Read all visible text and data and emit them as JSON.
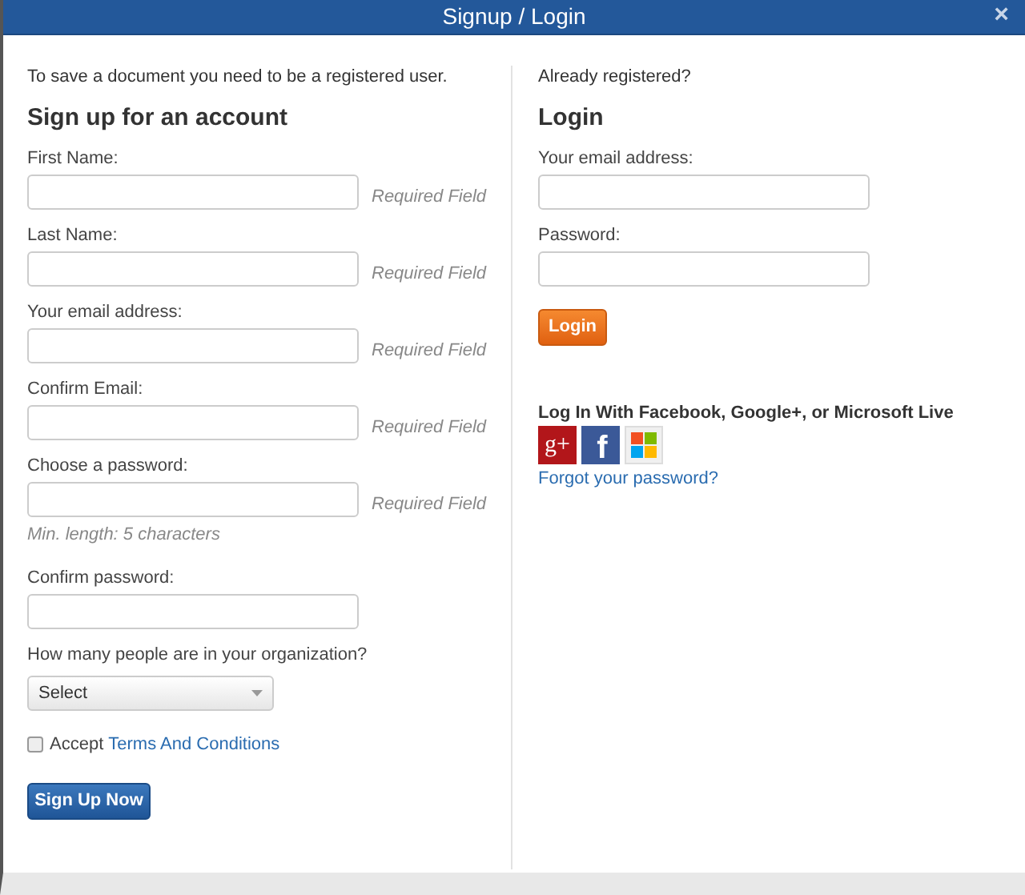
{
  "window": {
    "title": "Signup / Login",
    "close": "×"
  },
  "signup": {
    "intro": "To save a document you need to be a registered user.",
    "heading": "Sign up for an account",
    "fields": [
      {
        "label": "First Name:",
        "note": "Required Field"
      },
      {
        "label": "Last Name:",
        "note": "Required Field"
      },
      {
        "label": "Your email address:",
        "note": "Required Field"
      },
      {
        "label": "Confirm Email:",
        "note": "Required Field"
      },
      {
        "label": "Choose a password:",
        "note": "Required Field",
        "hint": "Min. length: 5 characters"
      },
      {
        "label": "Confirm password:"
      }
    ],
    "org": {
      "label": "How many people are in your organization?",
      "value": "Select"
    },
    "terms": {
      "checked": false,
      "text": "Accept",
      "link": "Terms And Conditions"
    },
    "submit": "Sign Up Now"
  },
  "login": {
    "intro": "Already registered?",
    "heading": "Login",
    "fields": [
      {
        "label": "Your email address:"
      },
      {
        "label": "Password:"
      }
    ],
    "submit": "Login",
    "social_heading": "Log In With Facebook, Google+, or Microsoft Live",
    "social": [
      {
        "kind": "google",
        "label": "g+"
      },
      {
        "kind": "facebook",
        "label": "f"
      },
      {
        "kind": "microsoft"
      }
    ],
    "forgot": "Forgot your password?"
  }
}
